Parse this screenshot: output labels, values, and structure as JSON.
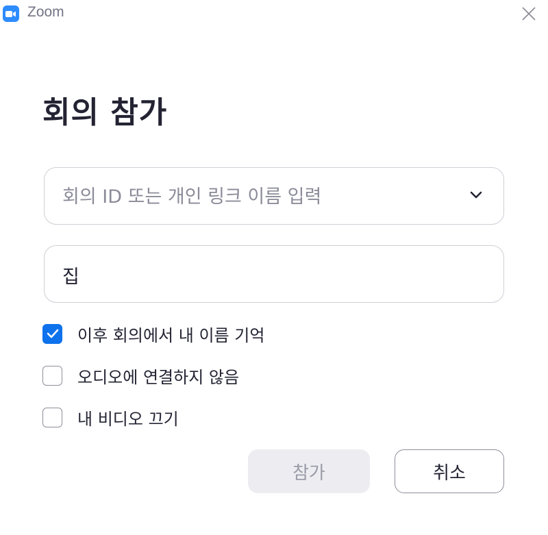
{
  "window": {
    "title": "Zoom",
    "app_icon": "zoom-camera-icon",
    "close_icon": "close-icon"
  },
  "dialog": {
    "heading": "회의 참가",
    "meeting_id": {
      "value": "",
      "placeholder": "회의 ID 또는 개인 링크 이름 입력",
      "dropdown_icon": "chevron-down-icon"
    },
    "display_name": {
      "value": "집",
      "placeholder": ""
    },
    "options": [
      {
        "label": "이후 회의에서 내 이름 기억",
        "checked": true
      },
      {
        "label": "오디오에 연결하지 않음",
        "checked": false
      },
      {
        "label": "내 비디오 끄기",
        "checked": false
      }
    ],
    "buttons": {
      "join_label": "참가",
      "join_enabled": false,
      "cancel_label": "취소"
    }
  },
  "colors": {
    "accent": "#0E72ED",
    "brand": "#2D8CFF",
    "text": "#232333",
    "disabled_bg": "#EDEDF1",
    "disabled_text": "#9B9BA8"
  }
}
